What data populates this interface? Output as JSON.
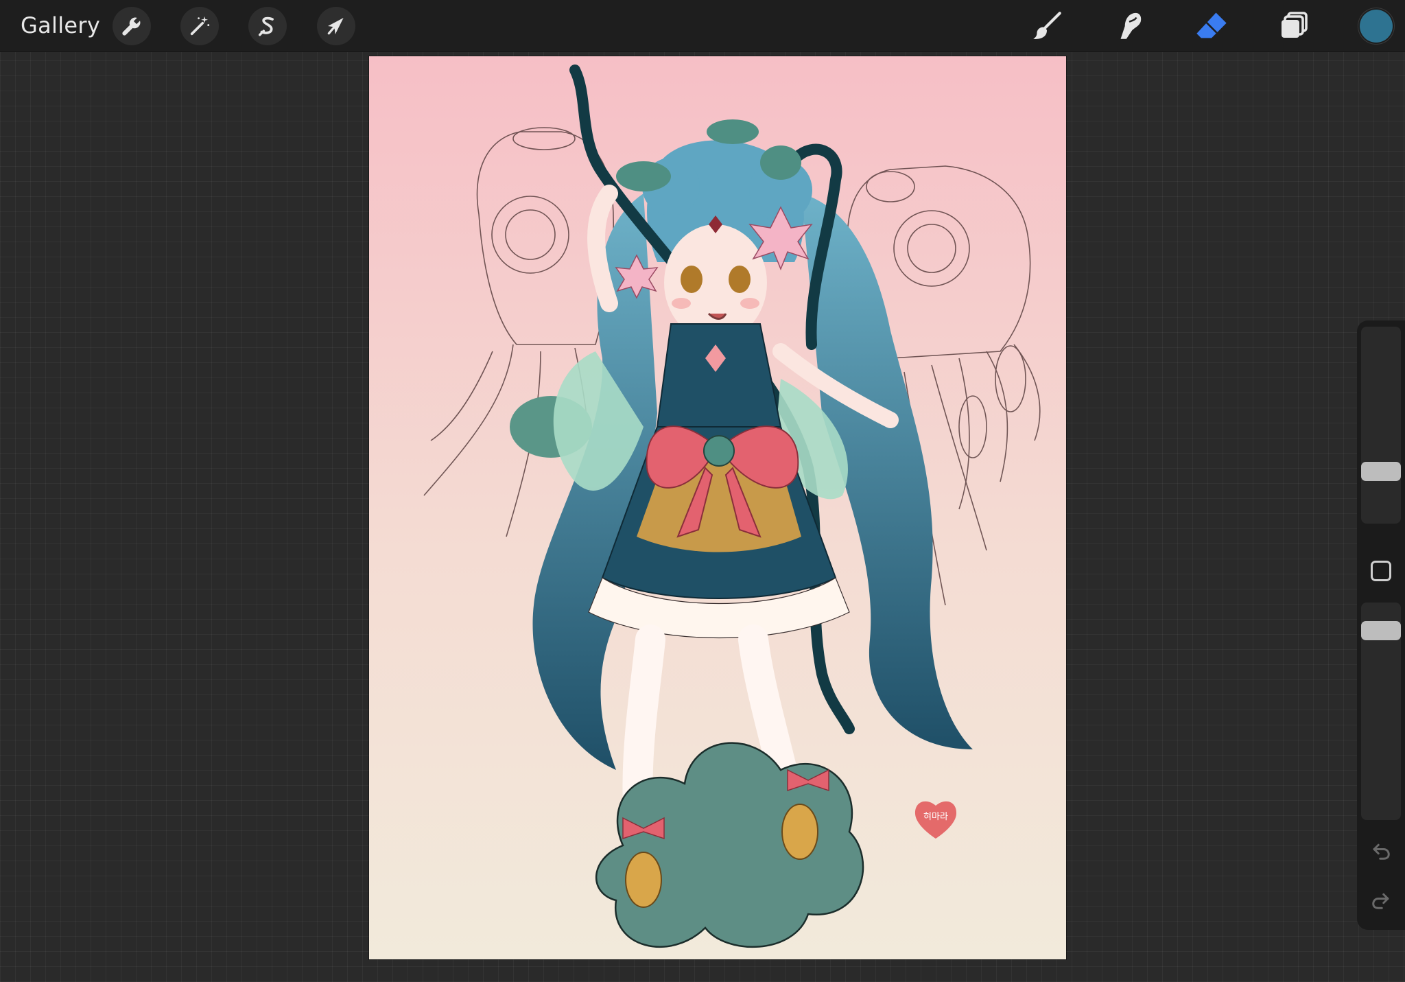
{
  "toolbar": {
    "gallery_label": "Gallery",
    "left_tools": [
      {
        "name": "actions",
        "icon": "wrench-icon"
      },
      {
        "name": "adjustments",
        "icon": "magic-wand-icon"
      },
      {
        "name": "selection",
        "icon": "selection-s-icon"
      },
      {
        "name": "transform",
        "icon": "arrow-cursor-icon"
      }
    ],
    "right_tools": [
      {
        "name": "brush",
        "icon": "brush-icon",
        "active": false
      },
      {
        "name": "smudge",
        "icon": "smudge-finger-icon",
        "active": false
      },
      {
        "name": "eraser",
        "icon": "eraser-icon",
        "active": true
      },
      {
        "name": "layers",
        "icon": "layers-icon",
        "active": false
      }
    ],
    "current_color": "#2e7391",
    "active_tool_color": "#3a7cf0"
  },
  "sidebar": {
    "brush_size_icon": "size-slider",
    "opacity_icon": "opacity-slider",
    "modifier_icon": "square-modifier-icon",
    "undo_icon": "undo-arrow-icon",
    "redo_icon": "redo-arrow-icon"
  },
  "canvas": {
    "gradient_top": "#f6bfc6",
    "gradient_bottom": "#f2eadb",
    "signature": "혀마라"
  }
}
